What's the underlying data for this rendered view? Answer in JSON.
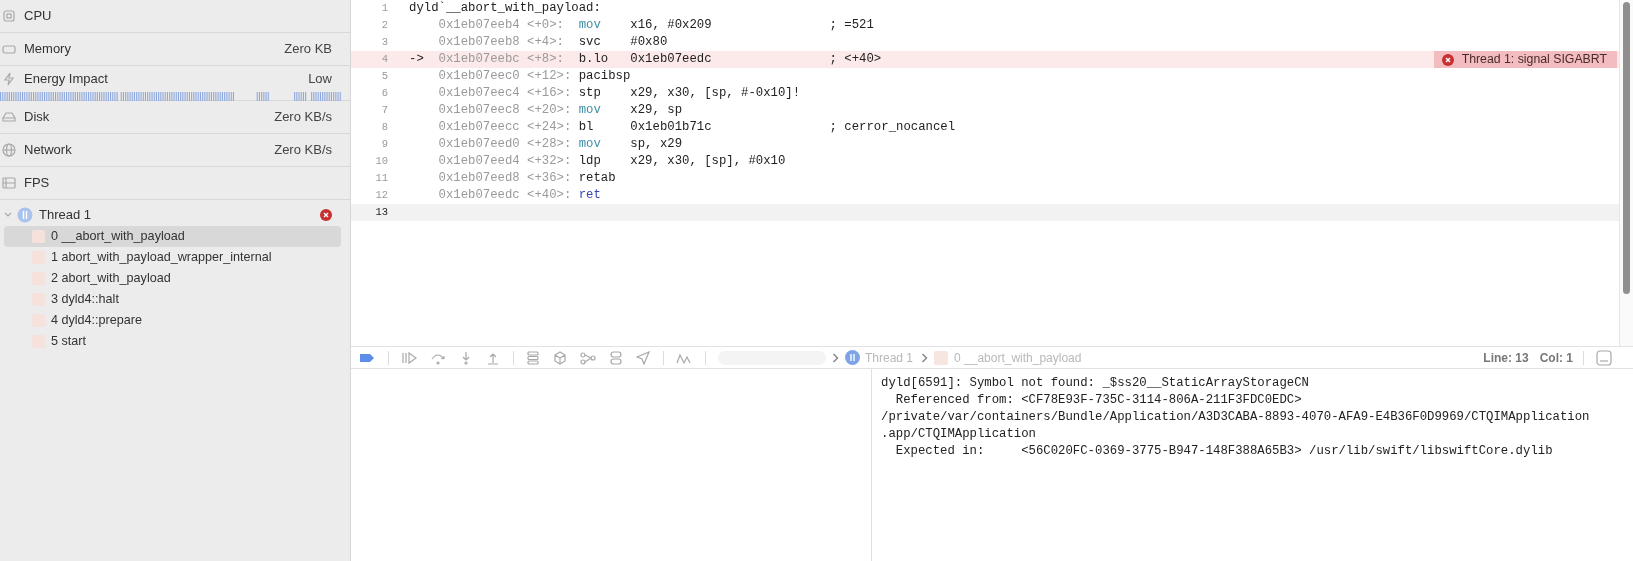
{
  "sidebar": {
    "gauges": [
      {
        "kind": "cpu",
        "label": "CPU"
      },
      {
        "kind": "memory",
        "label": "Memory",
        "value": "Zero KB"
      },
      {
        "kind": "energy",
        "label": "Energy Impact",
        "value": "Low"
      },
      {
        "kind": "disk",
        "label": "Disk",
        "value": "Zero KB/s"
      },
      {
        "kind": "network",
        "label": "Network",
        "value": "Zero KB/s"
      },
      {
        "kind": "fps",
        "label": "FPS"
      }
    ],
    "thread": {
      "label": "Thread 1",
      "expanded": true,
      "error": true,
      "frames": [
        {
          "label": "0 __abort_with_payload",
          "selected": true
        },
        {
          "label": "1 abort_with_payload_wrapper_internal",
          "selected": false
        },
        {
          "label": "2 abort_with_payload",
          "selected": false
        },
        {
          "label": "3 dyld4::halt",
          "selected": false
        },
        {
          "label": "4 dyld4::prepare",
          "selected": false
        },
        {
          "label": "5 start",
          "selected": false
        }
      ]
    }
  },
  "editor": {
    "lines": [
      {
        "number": "1",
        "kind": "label",
        "text": "dyld`__abort_with_payload:",
        "cursor": false
      },
      {
        "number": "2",
        "kind": "instruction",
        "address": "0x1eb07eeb4",
        "offset": "<+0>:",
        "mnemonic": {
          "text": "mov",
          "color": "#3e8fa6"
        },
        "operand": "x16, #0x209",
        "comment": "; =521",
        "cursor": false
      },
      {
        "number": "3",
        "kind": "instruction",
        "address": "0x1eb07eeb8",
        "offset": "<+4>:",
        "mnemonic": {
          "text": "svc",
          "color": "#222222"
        },
        "operand": "#0x80",
        "cursor": false
      },
      {
        "number": "4",
        "kind": "instruction",
        "arrow": "->",
        "address": "0x1eb07eebc",
        "offset": "<+8>:",
        "mnemonic": {
          "text": "b.lo",
          "color": "#222222"
        },
        "operand": "0x1eb07eedc",
        "comment": "; <+40>",
        "annotation": "Thread 1: signal SIGABRT",
        "cursor": false
      },
      {
        "number": "5",
        "kind": "instruction",
        "address": "0x1eb07eec0",
        "offset": "<+12>:",
        "mnemonic": {
          "text": "pacibsp",
          "color": "#222222"
        },
        "cursor": false
      },
      {
        "number": "6",
        "kind": "instruction",
        "address": "0x1eb07eec4",
        "offset": "<+16>:",
        "mnemonic": {
          "text": "stp",
          "color": "#222222"
        },
        "operand": "x29, x30, [sp, #-0x10]!",
        "cursor": false
      },
      {
        "number": "7",
        "kind": "instruction",
        "address": "0x1eb07eec8",
        "offset": "<+20>:",
        "mnemonic": {
          "text": "mov",
          "color": "#3e8fa6"
        },
        "operand": "x29, sp",
        "cursor": false
      },
      {
        "number": "8",
        "kind": "instruction",
        "address": "0x1eb07eecc",
        "offset": "<+24>:",
        "mnemonic": {
          "text": "bl",
          "color": "#222222"
        },
        "operand": "0x1eb01b71c",
        "comment": "; cerror_nocancel",
        "cursor": false
      },
      {
        "number": "9",
        "kind": "instruction",
        "address": "0x1eb07eed0",
        "offset": "<+28>:",
        "mnemonic": {
          "text": "mov",
          "color": "#3e8fa6"
        },
        "operand": "sp, x29",
        "cursor": false
      },
      {
        "number": "10",
        "kind": "instruction",
        "address": "0x1eb07eed4",
        "offset": "<+32>:",
        "mnemonic": {
          "text": "ldp",
          "color": "#222222"
        },
        "operand": "x29, x30, [sp], #0x10",
        "cursor": false
      },
      {
        "number": "11",
        "kind": "instruction",
        "address": "0x1eb07eed8",
        "offset": "<+36>:",
        "mnemonic": {
          "text": "retab",
          "color": "#222222"
        },
        "cursor": false
      },
      {
        "number": "12",
        "kind": "instruction",
        "address": "0x1eb07eedc",
        "offset": "<+40>:",
        "mnemonic": {
          "text": "ret",
          "color": "#3748b8"
        },
        "cursor": false
      },
      {
        "number": "13",
        "kind": "empty",
        "cursor": true
      }
    ]
  },
  "debug_bar": {
    "breakpoints_active": true,
    "breadcrumb": [
      {
        "kind": "thread",
        "label": "Thread 1"
      },
      {
        "kind": "frame",
        "label": "0 __abort_with_payload"
      }
    ],
    "line": "Line: 13",
    "column": "Col: 1"
  },
  "console": {
    "lines": [
      "dyld[6591]: Symbol not found: _$ss20__StaticArrayStorageCN",
      "  Referenced from: <CF78E93F-735C-3114-806A-211F3FDC0EDC>",
      "/private/var/containers/Bundle/Application/A3D3CABA-8893-4070-AFA9-E4B36F0D9969/CTQIMApplication",
      ".app/CTQIMApplication",
      "  Expected in:     <56C020FC-0369-3775-B947-148F388A65B3> /usr/lib/swift/libswiftCore.dylib"
    ]
  }
}
